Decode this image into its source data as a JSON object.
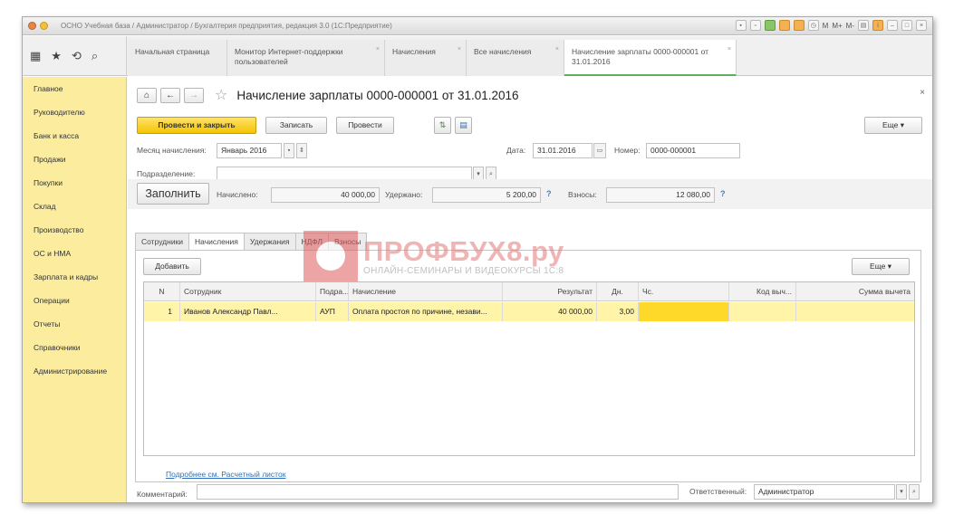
{
  "window": {
    "title": "ОСНО Учебная база / Администратор / Бухгалтерия предприятия, редакция 3.0 (1С:Предприятие)",
    "memory_buttons": [
      "M",
      "M+",
      "M-"
    ]
  },
  "tabs": [
    {
      "label": "Начальная страница"
    },
    {
      "label": "Монитор Интернет-поддержки пользователей"
    },
    {
      "label": "Начисления"
    },
    {
      "label": "Все начисления"
    },
    {
      "label": "Начисление зарплаты 0000-000001 от 31.01.2016"
    }
  ],
  "sidebar": {
    "items": [
      {
        "label": "Главное"
      },
      {
        "label": "Руководителю"
      },
      {
        "label": "Банк и касса"
      },
      {
        "label": "Продажи"
      },
      {
        "label": "Покупки"
      },
      {
        "label": "Склад"
      },
      {
        "label": "Производство"
      },
      {
        "label": "ОС и НМА"
      },
      {
        "label": "Зарплата и кадры"
      },
      {
        "label": "Операции"
      },
      {
        "label": "Отчеты"
      },
      {
        "label": "Справочники"
      },
      {
        "label": "Администрирование"
      }
    ]
  },
  "document": {
    "title": "Начисление зарплаты 0000-000001 от 31.01.2016",
    "toolbar": {
      "post_close": "Провести и закрыть",
      "save": "Записать",
      "post": "Провести",
      "more": "Еще"
    },
    "fields": {
      "month_label": "Месяц начисления:",
      "month_value": "Январь 2016",
      "date_label": "Дата:",
      "date_value": "31.01.2016",
      "number_label": "Номер:",
      "number_value": "0000-000001",
      "dept_label": "Подразделение:",
      "dept_value": ""
    },
    "summary": {
      "fill_button": "Заполнить",
      "accrued_label": "Начислено:",
      "accrued_value": "40 000,00",
      "withheld_label": "Удержано:",
      "withheld_value": "5 200,00",
      "contrib_label": "Взносы:",
      "contrib_value": "12 080,00",
      "help": "?"
    },
    "form_tabs": [
      {
        "label": "Сотрудники"
      },
      {
        "label": "Начисления"
      },
      {
        "label": "Удержания"
      },
      {
        "label": "НДФЛ"
      },
      {
        "label": "Взносы"
      }
    ],
    "panel": {
      "add_button": "Добавить",
      "more": "Еще"
    },
    "grid": {
      "columns": [
        "N",
        "Сотрудник",
        "Подра...",
        "Начисление",
        "Результат",
        "Дн.",
        "Чс.",
        "Код выч...",
        "Сумма вычета"
      ],
      "rows": [
        [
          "1",
          "Иванов Александр Павл...",
          "АУП",
          "Оплата простоя по причине, незави...",
          "40 000,00",
          "3,00",
          "",
          "",
          ""
        ]
      ]
    },
    "details_link": "Подробнее см. Расчетный листок",
    "comment_label": "Комментарий:",
    "comment_value": "",
    "responsible_label": "Ответственный:",
    "responsible_value": "Администратор"
  },
  "watermark": {
    "brand": "ПРОФБУХ8.ру",
    "tagline": "ОНЛАЙН-СЕМИНАРЫ И ВИДЕОКУРСЫ 1С:8"
  },
  "colors": {
    "sidebar_bg": "#fbed9d",
    "primary_button": "#f4c300",
    "selected_row": "#fff4a8",
    "highlight_cell": "#ffd92a",
    "link": "#2f6fb7",
    "watermark": "#e05a5a"
  }
}
